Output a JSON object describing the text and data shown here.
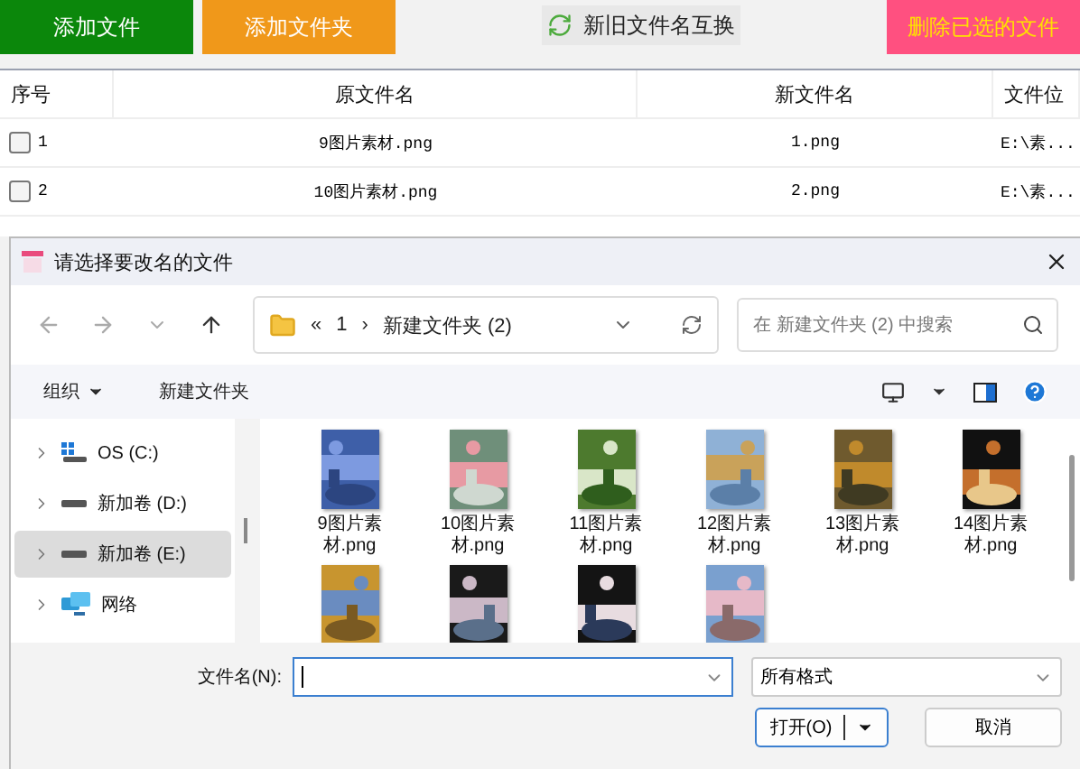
{
  "toolbar": {
    "buttons": [
      {
        "label": "添加文件",
        "kind": "green"
      },
      {
        "label": "添加文件夹",
        "kind": "orange"
      },
      {
        "label": "新旧文件名互换",
        "kind": "swap"
      },
      {
        "label": "删除已选的文件",
        "kind": "pink"
      }
    ]
  },
  "table": {
    "columns": [
      "序号",
      "原文件名",
      "新文件名",
      "文件位"
    ],
    "rows": [
      {
        "index": "1",
        "checked": false,
        "original": "9图片素材.png",
        "new": "1.png",
        "location": "E:\\素..."
      },
      {
        "index": "2",
        "checked": false,
        "original": "10图片素材.png",
        "new": "2.png",
        "location": "E:\\素..."
      }
    ]
  },
  "dialog": {
    "title": "请选择要改名的文件",
    "breadcrumb": [
      "«",
      "1",
      "›",
      "新建文件夹 (2)"
    ],
    "search": {
      "placeholder": "在 新建文件夹 (2) 中搜索"
    },
    "commands": [
      {
        "label": "组织",
        "kind": "menu"
      },
      {
        "label": "新建文件夹",
        "kind": "plain"
      }
    ],
    "sidebar": [
      {
        "label": "OS (C:)",
        "kind": "os",
        "selected": false
      },
      {
        "label": "新加卷 (D:)",
        "kind": "drive",
        "selected": false
      },
      {
        "label": "新加卷 (E:)",
        "kind": "drive",
        "selected": true
      },
      {
        "label": "网络",
        "kind": "network",
        "selected": false
      }
    ],
    "files": [
      {
        "kind": "file",
        "name": "9图片素材.png"
      },
      {
        "kind": "file",
        "name": "10图片素材.png"
      },
      {
        "kind": "file",
        "name": "11图片素材.png"
      },
      {
        "kind": "file",
        "name": "12图片素材.png"
      },
      {
        "kind": "file",
        "name": "13图片素材.png"
      },
      {
        "kind": "file",
        "name": "14图片素材.png"
      },
      {
        "kind": "picture"
      },
      {
        "kind": "picture"
      },
      {
        "kind": "picture"
      },
      {
        "kind": "picture"
      }
    ],
    "filename_label": "文件名(N):",
    "filter": {
      "value": "所有格式"
    },
    "buttons": [
      {
        "label": "打开(O)",
        "kind": "split"
      },
      {
        "label": "取消",
        "kind": "plain"
      }
    ]
  }
}
